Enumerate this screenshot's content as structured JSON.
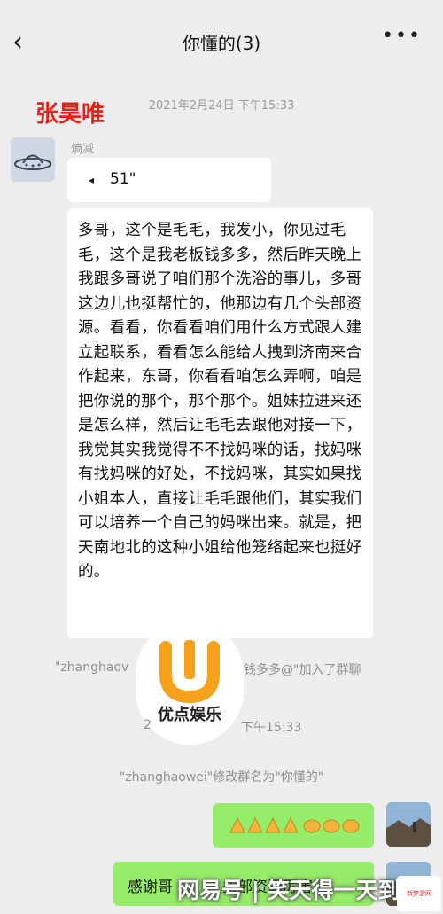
{
  "header": {
    "back_icon": "chevron-left-icon",
    "title": "你懂的(3)",
    "more_icon": "more-icon"
  },
  "watermark_name": "张昊唯",
  "messages": {
    "time1": "2021年2月24日 下午15:33",
    "sender": "熵减",
    "quote": "51\"",
    "long_text": "多哥，这个是毛毛，我发小，你见过毛毛，这个是我老板钱多多，然后昨天晚上我跟多哥说了咱们那个洗浴的事儿，多哥这边儿也挺帮忙的，他那边有几个头部资源。看看，你看看咱们用什么方式跟人建立起联系，看看怎么能给人拽到济南来合作起来，东哥，你看看咱怎么弄啊，咱是把你说的那个，那个那个。姐妹拉进来还是怎么样，然后让毛毛去跟他对接一下，我觉其实我觉得不不找妈咪的话，找妈咪有找妈咪的好处，不找妈咪，其实如果找小姐本人，直接让毛毛跟他们，其实我们可以培养一个自己的妈咪出来。就是，把天南地北的这种小姐给他笼络起来也挺好的。",
    "sys_join_left": "\"zhanghaov",
    "sys_join_right": "钱多多@\"加入了群聊",
    "time2_left": "2",
    "time2_right": "下午15:33",
    "sys_rename": "\"zhanghaowei\"修改群名为\"你懂的\"",
    "green_reply": "感谢哥",
    "green_reply_tail": "头部资源厉害了"
  },
  "logo_text": "优点娱乐",
  "bottom_watermark": "网易号 | 笑天得一天到晚",
  "corner_logo_text": "新梦游网",
  "colors": {
    "bg": "#ededed",
    "green_bubble": "#95ec69",
    "watermark_red": "#e42419",
    "logo_orange": "#f5a21a"
  }
}
